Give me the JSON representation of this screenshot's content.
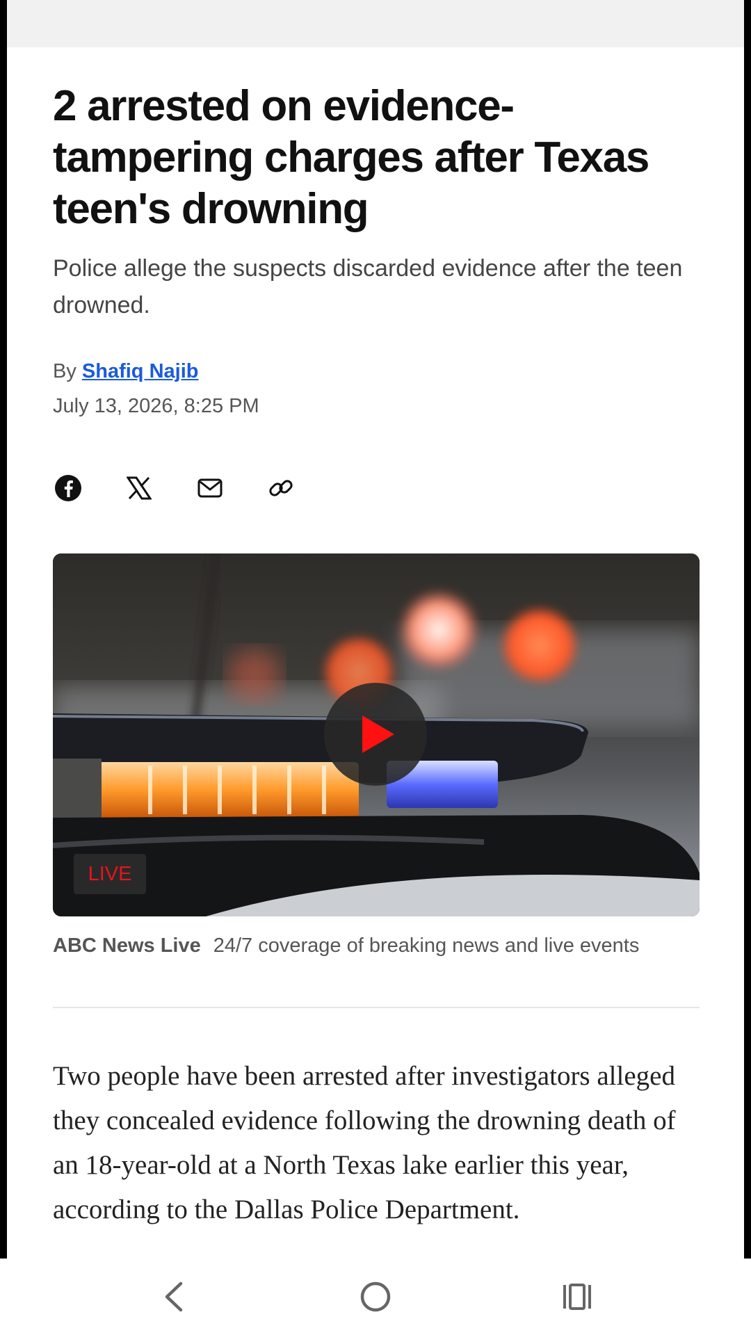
{
  "article": {
    "headline": "2 arrested on evidence-tampering charges after Texas teen's drowning",
    "subheadline": "Police allege the suspects discarded evidence after the teen drowned.",
    "byline_prefix": "By",
    "author": "Shafiq Najib",
    "timestamp": "July 13, 2026, 8:25 PM",
    "body_first_paragraph": "Two people have been arrested after investigators alleged they concealed evidence following the drowning death of an 18-year-old at a North Texas lake earlier this year, according to the Dallas Police Department."
  },
  "share": {
    "icons": [
      "facebook-icon",
      "x-icon",
      "mail-icon",
      "link-icon"
    ]
  },
  "video": {
    "badge": "LIVE",
    "caption_source": "ABC News Live",
    "caption_text": "24/7 coverage of breaking news and live events"
  },
  "colors": {
    "link": "#1a5adc",
    "live_red": "#e8141b",
    "play_red": "#ff1111"
  },
  "nav": {
    "icons": [
      "back-icon",
      "home-icon",
      "recents-icon"
    ]
  }
}
